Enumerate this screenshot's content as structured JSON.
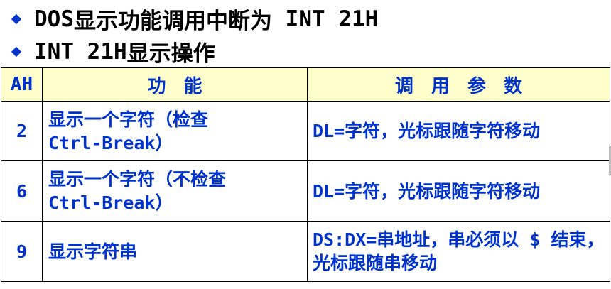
{
  "bullets": {
    "line1_prefix": "DOS",
    "line1_text": "显示功能调用中断为",
    "line1_code": " INT 21H",
    "line2_code": "INT 21H",
    "line2_text": "显示操作"
  },
  "table": {
    "headers": {
      "ah": "AH",
      "function": "功 能",
      "params": "调 用 参 数"
    },
    "rows": [
      {
        "ah": "2",
        "function_line1": "显示一个字符（检查",
        "function_line2": "Ctrl-Break）",
        "params": "DL=字符，光标跟随字符移动"
      },
      {
        "ah": "6",
        "function_line1": "显示一个字符（不检查",
        "function_line2": "Ctrl-Break）",
        "params": "DL=字符，光标跟随字符移动"
      },
      {
        "ah": "9",
        "function_line1": "显示字符串",
        "function_line2": "",
        "params": "DS:DX=串地址，串必须以 $ 结束，光标跟随串移动"
      }
    ]
  },
  "colors": {
    "header_bg": "#ffffcc",
    "text_blue": "#0033cc",
    "bullet_text": "#000000"
  }
}
